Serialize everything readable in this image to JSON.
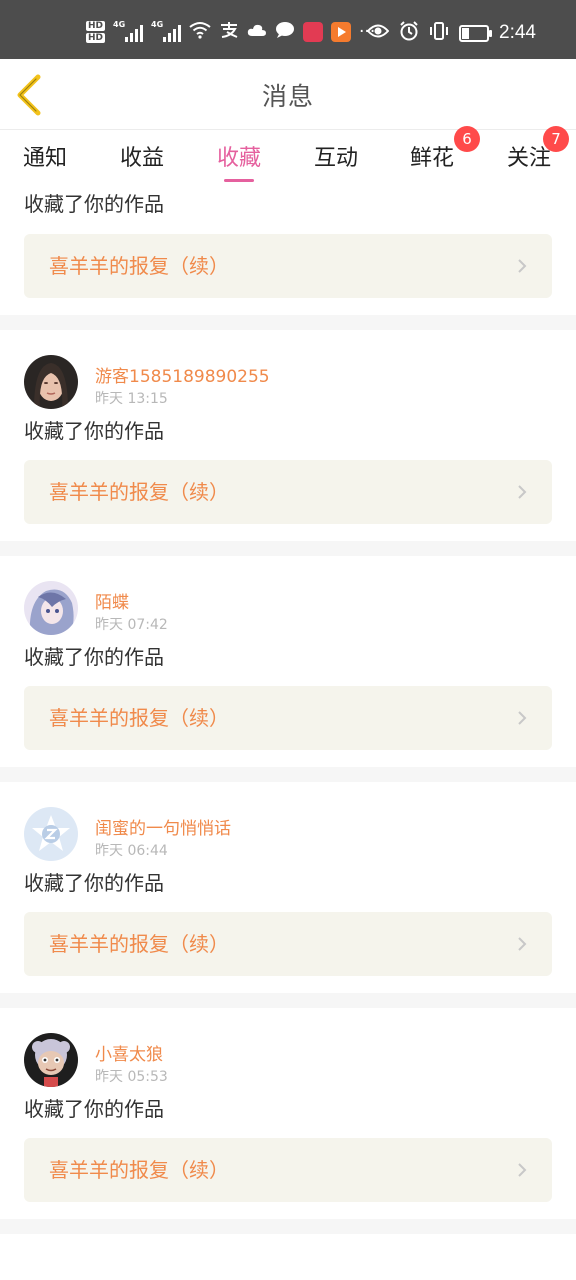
{
  "status_bar": {
    "hd1": "HD",
    "hd2": "HD",
    "net1": "4G",
    "net2": "4G",
    "time": "2:44",
    "more": "···"
  },
  "header": {
    "title": "消息",
    "back_icon": "chevron-left-icon",
    "accent": "#f2c21b"
  },
  "tabs": [
    {
      "label": "通知",
      "active": false
    },
    {
      "label": "收益",
      "active": false
    },
    {
      "label": "收藏",
      "active": true
    },
    {
      "label": "互动",
      "active": false
    },
    {
      "label": "鲜花",
      "active": false,
      "badge": "6"
    },
    {
      "label": "关注",
      "active": false,
      "badge": "7"
    }
  ],
  "colors": {
    "active_tab": "#e5609e",
    "username": "#f08a4b",
    "badge": "#ff4a4a",
    "work_bg": "#f5f4ec"
  },
  "first_partial": {
    "action": "收藏了你的作品",
    "work_title": "喜羊羊的报复（续）"
  },
  "items": [
    {
      "username": "游客1585189890255",
      "time": "昨天 13:15",
      "action": "收藏了你的作品",
      "work_title": "喜羊羊的报复（续）"
    },
    {
      "username": "陌蝶",
      "time": "昨天 07:42",
      "action": "收藏了你的作品",
      "work_title": "喜羊羊的报复（续）"
    },
    {
      "username": "闺蜜的一句悄悄话",
      "time": "昨天 06:44",
      "action": "收藏了你的作品",
      "work_title": "喜羊羊的报复（续）"
    },
    {
      "username": "小喜太狼",
      "time": "昨天 05:53",
      "action": "收藏了你的作品",
      "work_title": "喜羊羊的报复（续）"
    }
  ]
}
